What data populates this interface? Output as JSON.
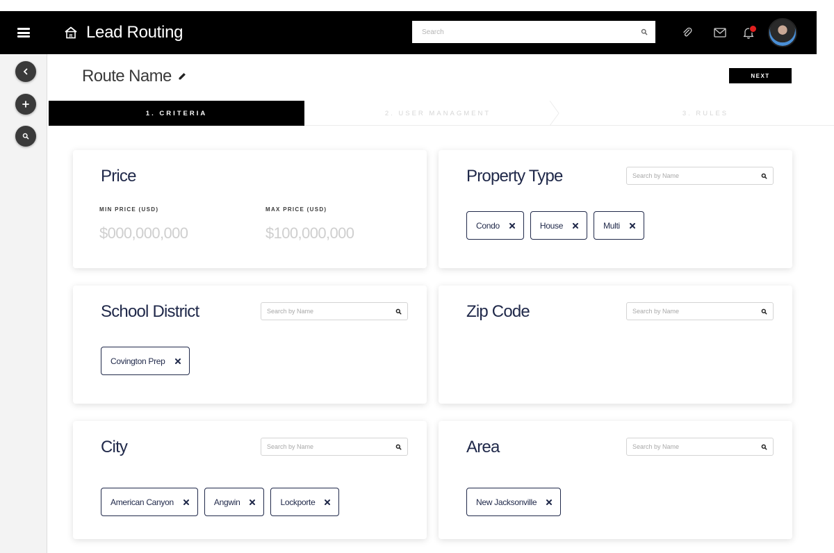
{
  "app": {
    "title": "Lead Routing"
  },
  "topbar": {
    "search_placeholder": "Search"
  },
  "route": {
    "name": "Route Name",
    "next_label": "NEXT"
  },
  "steps": [
    {
      "label": "1. CRITERIA"
    },
    {
      "label": "2. USER MANAGMENT"
    },
    {
      "label": "3. RULES"
    }
  ],
  "price": {
    "title": "Price",
    "min_label": "MIN PRICE (USD)",
    "max_label": "MAX PRICE (USD)",
    "min_placeholder": "$000,000,000",
    "max_placeholder": "$100,000,000"
  },
  "property_type": {
    "title": "Property Type",
    "search_placeholder": "Search by Name",
    "chips": [
      "Condo",
      "House",
      "Multi"
    ]
  },
  "school_district": {
    "title": "School District",
    "search_placeholder": "Search by Name",
    "chips": [
      "Covington Prep"
    ]
  },
  "zip_code": {
    "title": "Zip Code",
    "search_placeholder": "Search by Name",
    "chips": []
  },
  "city": {
    "title": "City",
    "search_placeholder": "Search by Name",
    "chips": [
      "American Canyon",
      "Angwin",
      "Lockporte"
    ]
  },
  "area": {
    "title": "Area",
    "search_placeholder": "Search by Name",
    "chips": [
      "New Jacksonville"
    ]
  },
  "icons": {
    "menu": "hamburger-menu-icon",
    "back": "chevron-left-icon",
    "add": "plus-icon",
    "search": "search-icon",
    "home": "house-icon",
    "attach": "paperclip-icon",
    "mail": "mail-icon",
    "notifications": "bell-icon",
    "edit": "pencil-icon",
    "remove": "close-icon"
  },
  "colors": {
    "topbar": "#000000",
    "text": "#20294a",
    "badge": "#e0201f"
  }
}
